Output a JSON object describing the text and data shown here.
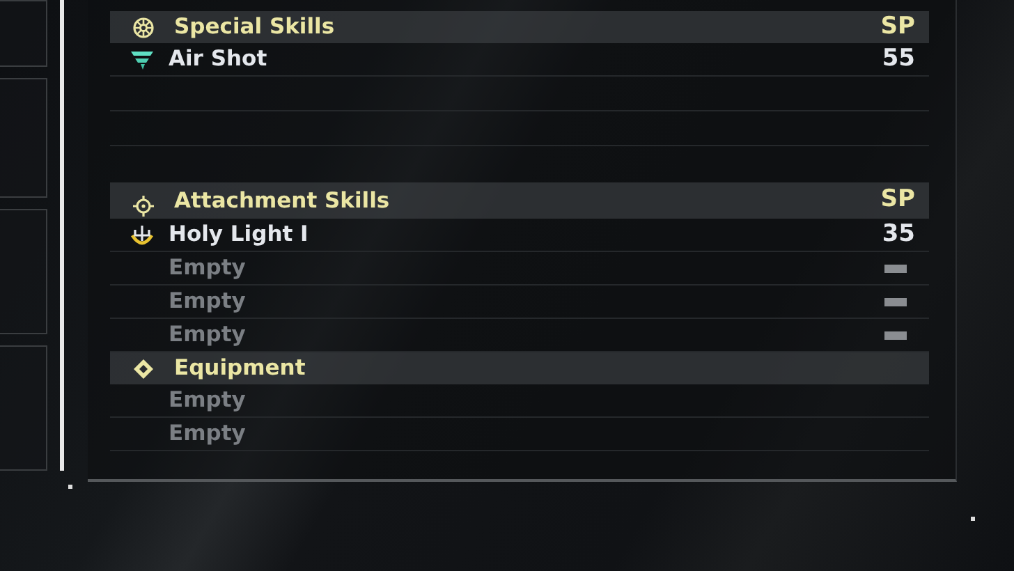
{
  "sections": [
    {
      "kind": "special",
      "title": "Special Skills",
      "sp_header": "SP",
      "rows": [
        {
          "kind": "skill",
          "name": "Air Shot",
          "sp": "55"
        },
        {
          "kind": "blank"
        },
        {
          "kind": "blank"
        }
      ]
    },
    {
      "kind": "attachment",
      "title": "Attachment Skills",
      "sp_header": "SP",
      "rows": [
        {
          "kind": "skill",
          "name": "Holy Light I",
          "sp": "35"
        },
        {
          "kind": "empty",
          "name": "Empty"
        },
        {
          "kind": "empty",
          "name": "Empty"
        },
        {
          "kind": "empty",
          "name": "Empty"
        }
      ]
    },
    {
      "kind": "equipment",
      "title": "Equipment",
      "rows": [
        {
          "kind": "empty",
          "name": "Empty"
        },
        {
          "kind": "empty",
          "name": "Empty"
        }
      ]
    }
  ]
}
